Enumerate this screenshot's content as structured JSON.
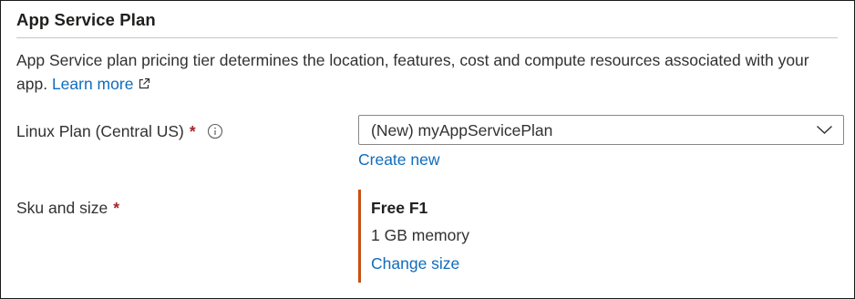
{
  "section": {
    "title": "App Service Plan"
  },
  "description": {
    "text": "App Service plan pricing tier determines the location, features, cost and compute resources associated with your app.",
    "learn_more": "Learn more",
    "learn_more_icon": "external-link-icon"
  },
  "plan": {
    "label": "Linux Plan (Central US)",
    "required_mark": "*",
    "info_icon": "info-icon",
    "selected_value": "(New) myAppServicePlan",
    "dropdown_icon": "chevron-down-icon",
    "create_new": "Create new"
  },
  "sku": {
    "label": "Sku and size",
    "required_mark": "*",
    "name": "Free F1",
    "memory": "1 GB memory",
    "change_size": "Change size",
    "accent_color": "#ca5010"
  },
  "colors": {
    "link": "#0f6cbd",
    "required": "#a4262c"
  }
}
